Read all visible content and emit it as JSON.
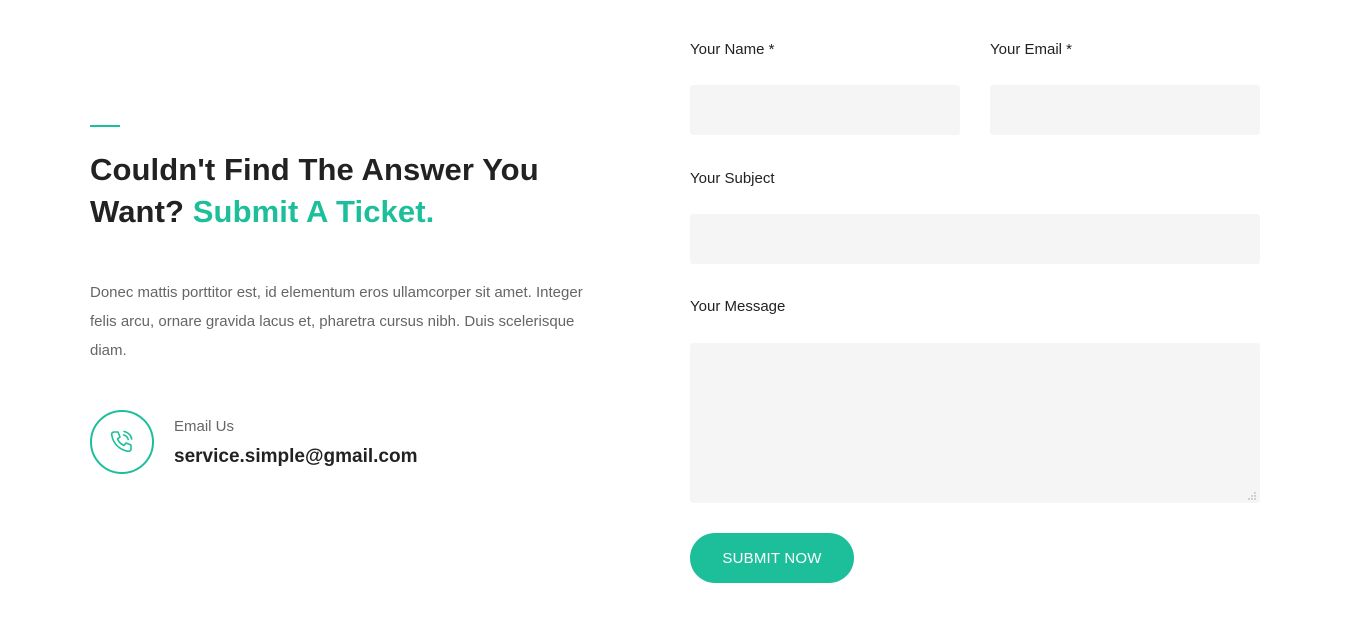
{
  "section": {
    "heading_main": "Couldn't Find The Answer You Want?",
    "heading_highlight": "Submit A Ticket.",
    "description": "Donec mattis porttitor est, id elementum eros ullamcorper sit amet. Integer felis arcu, ornare gravida lacus et, pharetra cursus nibh. Duis scelerisque diam.",
    "contact": {
      "icon": "phone-icon",
      "label": "Email Us",
      "value": "service.simple@gmail.com"
    }
  },
  "form": {
    "name_label": "Your Name *",
    "name_value": "",
    "email_label": "Your Email *",
    "email_value": "",
    "subject_label": "Your Subject",
    "subject_value": "",
    "message_label": "Your Message",
    "message_value": "",
    "submit_label": "SUBMIT NOW"
  },
  "colors": {
    "accent": "#1dbf9a",
    "heading": "#222222",
    "body_text": "#666666",
    "input_bg": "#f5f5f5"
  }
}
